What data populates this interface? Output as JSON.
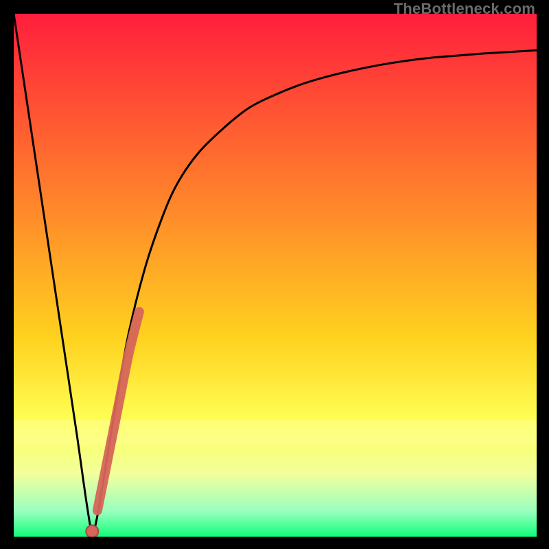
{
  "watermark": "TheBottleneck.com",
  "colors": {
    "gradient_top": "#ff1e3c",
    "gradient_mid1": "#ff6a2a",
    "gradient_mid2": "#ffd21f",
    "gradient_mid3": "#ffff66",
    "gradient_band": "#f6ff9c",
    "gradient_bottom": "#10ff7a",
    "curve": "#000000",
    "dot_fill": "#d6655a",
    "dot_stroke": "#a84a42"
  },
  "chart_data": {
    "type": "line",
    "title": "",
    "xlabel": "",
    "ylabel": "",
    "xlim": [
      0,
      100
    ],
    "ylim": [
      0,
      100
    ],
    "series": [
      {
        "name": "bottleneck-curve",
        "x": [
          0,
          3,
          6,
          9,
          12,
          14,
          15,
          16,
          18,
          20,
          22,
          25,
          28,
          31,
          35,
          40,
          45,
          50,
          55,
          60,
          65,
          70,
          75,
          80,
          85,
          90,
          95,
          100
        ],
        "y": [
          100,
          80,
          60,
          40,
          20,
          6,
          1,
          4,
          16,
          28,
          39,
          51,
          60,
          67,
          73,
          78,
          82,
          84.5,
          86.5,
          88,
          89.2,
          90.2,
          91,
          91.6,
          92,
          92.4,
          92.7,
          93
        ]
      },
      {
        "name": "highlight-segment",
        "x": [
          16,
          18,
          20,
          22,
          24
        ],
        "y": [
          5,
          15,
          25,
          35,
          43
        ]
      }
    ],
    "marker": {
      "name": "optimal-point",
      "x": 15,
      "y": 1
    }
  }
}
